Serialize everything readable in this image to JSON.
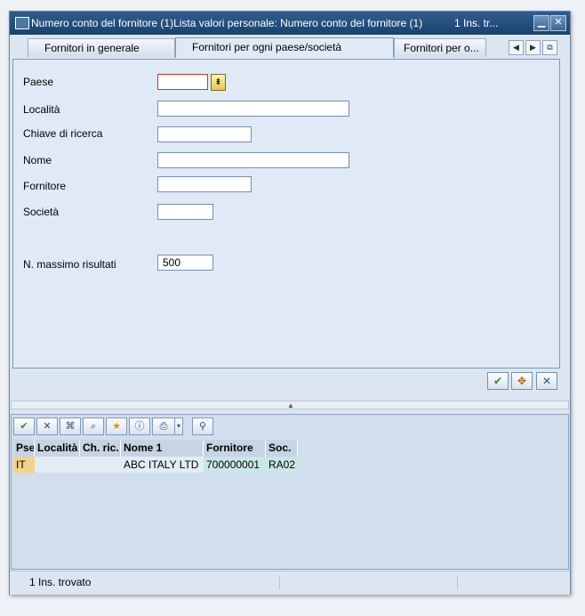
{
  "window": {
    "title": "Numero conto del fornitore (1)Lista valori personale: Numero conto del fornitore (1)",
    "count": "1 Ins. tr...",
    "minimize_glyph": "▁",
    "close_glyph": "✕"
  },
  "tabs": [
    {
      "label": "Fornitori in generale"
    },
    {
      "label": "Fornitori per ogni paese/società"
    },
    {
      "label": "Fornitori per o..."
    }
  ],
  "tab_nav": {
    "prev_glyph": "◀",
    "next_glyph": "▶",
    "menu_glyph": "⧉"
  },
  "form": {
    "paese": {
      "label": "Paese",
      "value": ""
    },
    "localita": {
      "label": "Località",
      "value": ""
    },
    "chiave": {
      "label": "Chiave di ricerca",
      "value": ""
    },
    "nome": {
      "label": "Nome",
      "value": ""
    },
    "fornitore": {
      "label": "Fornitore",
      "value": ""
    },
    "societa": {
      "label": "Società",
      "value": ""
    },
    "max": {
      "label": "N. massimo risultati",
      "value": "500"
    }
  },
  "icons": {
    "f4_help": "search-help-icon",
    "ok": "check-icon",
    "multiple": "multiple-selection-icon",
    "cancel": "cancel-icon"
  },
  "glyphs": {
    "f4": "⇟",
    "ok": "✔",
    "multi": "✥",
    "cancel": "✕",
    "grip": "▲",
    "t_ok": "✔",
    "t_cancel": "✕",
    "t_find": "⌘",
    "t_find_next": "⌕",
    "t_fav": "★",
    "t_info": "ⓘ",
    "t_print": "⎙",
    "t_dd": "▾",
    "t_pin": "⚲"
  },
  "results": {
    "columns": [
      "Pse",
      "Località",
      "Ch. ric.",
      "Nome 1",
      "Fornitore",
      "Soc."
    ],
    "rows": [
      {
        "pse": "IT",
        "localita": "",
        "chric": "",
        "nome": "ABC ITALY LTD",
        "fornitore": "700000001",
        "soc": "RA02"
      }
    ]
  },
  "status": {
    "text": "1 Ins. trovato"
  },
  "colors": {
    "key_cell": "#f3d28a",
    "highlight_cell": "#c9e7e4",
    "title_bar": "#1b416d"
  }
}
